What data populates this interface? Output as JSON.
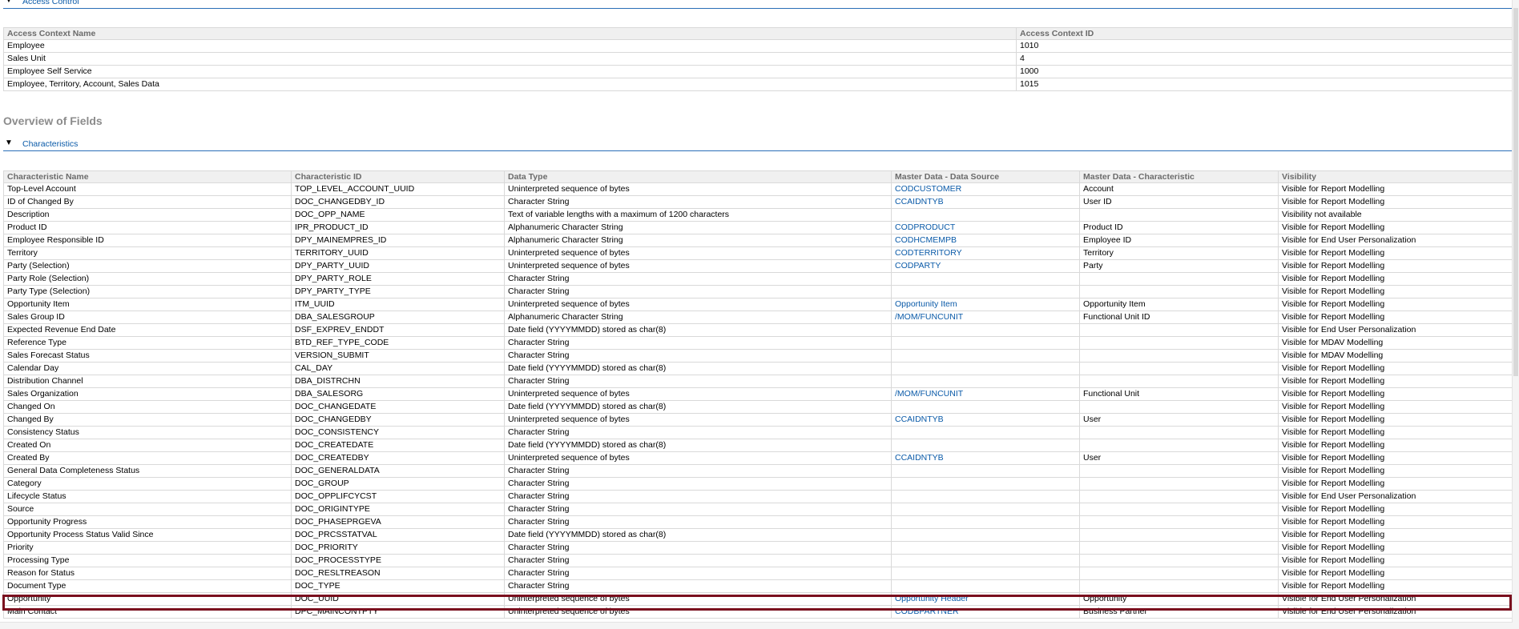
{
  "access_control": {
    "section_label": "Access Control",
    "columns": [
      "Access Context Name",
      "Access Context ID"
    ],
    "rows": [
      [
        "Employee",
        "1010"
      ],
      [
        "Sales Unit",
        "4"
      ],
      [
        "Employee Self Service",
        "1000"
      ],
      [
        "Employee, Territory, Account, Sales Data",
        "1015"
      ]
    ]
  },
  "overview_title": "Overview of Fields",
  "characteristics": {
    "section_label": "Characteristics",
    "columns": [
      "Characteristic Name",
      "Characteristic ID",
      "Data Type",
      "Master Data - Data Source",
      "Master Data - Characteristic",
      "Visibility"
    ],
    "rows": [
      [
        "Top-Level Account",
        "TOP_LEVEL_ACCOUNT_UUID",
        "Uninterpreted sequence of bytes",
        "CODCUSTOMER",
        "Account",
        "Visible for Report Modelling"
      ],
      [
        "ID of Changed By",
        "DOC_CHANGEDBY_ID",
        "Character String",
        "CCAIDNTYB",
        "User ID",
        "Visible for Report Modelling"
      ],
      [
        "Description",
        "DOC_OPP_NAME",
        "Text of variable lengths with a maximum of 1200 characters",
        "",
        "",
        "Visibility not available"
      ],
      [
        "Product ID",
        "IPR_PRODUCT_ID",
        "Alphanumeric Character String",
        "CODPRODUCT",
        "Product ID",
        "Visible for Report Modelling"
      ],
      [
        "Employee Responsible ID",
        "DPY_MAINEMPRES_ID",
        "Alphanumeric Character String",
        "CODHCMEMPB",
        "Employee ID",
        "Visible for End User Personalization"
      ],
      [
        "Territory",
        "TERRITORY_UUID",
        "Uninterpreted sequence of bytes",
        "CODTERRITORY",
        "Territory",
        "Visible for Report Modelling"
      ],
      [
        "Party (Selection)",
        "DPY_PARTY_UUID",
        "Uninterpreted sequence of bytes",
        "CODPARTY",
        "Party",
        "Visible for Report Modelling"
      ],
      [
        "Party Role (Selection)",
        "DPY_PARTY_ROLE",
        "Character String",
        "",
        "",
        "Visible for Report Modelling"
      ],
      [
        "Party Type (Selection)",
        "DPY_PARTY_TYPE",
        "Character String",
        "",
        "",
        "Visible for Report Modelling"
      ],
      [
        "Opportunity Item",
        "ITM_UUID",
        "Uninterpreted sequence of bytes",
        "Opportunity Item",
        "Opportunity Item",
        "Visible for Report Modelling"
      ],
      [
        "Sales Group ID",
        "DBA_SALESGROUP",
        "Alphanumeric Character String",
        "/MOM/FUNCUNIT",
        "Functional Unit ID",
        "Visible for Report Modelling"
      ],
      [
        "Expected Revenue End Date",
        "DSF_EXPREV_ENDDT",
        "Date field (YYYYMMDD) stored as char(8)",
        "",
        "",
        "Visible for End User Personalization"
      ],
      [
        "Reference Type",
        "BTD_REF_TYPE_CODE",
        "Character String",
        "",
        "",
        "Visible for MDAV Modelling"
      ],
      [
        "Sales Forecast Status",
        "VERSION_SUBMIT",
        "Character String",
        "",
        "",
        "Visible for MDAV Modelling"
      ],
      [
        "Calendar Day",
        "CAL_DAY",
        "Date field (YYYYMMDD) stored as char(8)",
        "",
        "",
        "Visible for Report Modelling"
      ],
      [
        "Distribution Channel",
        "DBA_DISTRCHN",
        "Character String",
        "",
        "",
        "Visible for Report Modelling"
      ],
      [
        "Sales Organization",
        "DBA_SALESORG",
        "Uninterpreted sequence of bytes",
        "/MOM/FUNCUNIT",
        "Functional Unit",
        "Visible for Report Modelling"
      ],
      [
        "Changed On",
        "DOC_CHANGEDATE",
        "Date field (YYYYMMDD) stored as char(8)",
        "",
        "",
        "Visible for Report Modelling"
      ],
      [
        "Changed By",
        "DOC_CHANGEDBY",
        "Uninterpreted sequence of bytes",
        "CCAIDNTYB",
        "User",
        "Visible for Report Modelling"
      ],
      [
        "Consistency Status",
        "DOC_CONSISTENCY",
        "Character String",
        "",
        "",
        "Visible for Report Modelling"
      ],
      [
        "Created On",
        "DOC_CREATEDATE",
        "Date field (YYYYMMDD) stored as char(8)",
        "",
        "",
        "Visible for Report Modelling"
      ],
      [
        "Created By",
        "DOC_CREATEDBY",
        "Uninterpreted sequence of bytes",
        "CCAIDNTYB",
        "User",
        "Visible for Report Modelling"
      ],
      [
        "General Data Completeness Status",
        "DOC_GENERALDATA",
        "Character String",
        "",
        "",
        "Visible for Report Modelling"
      ],
      [
        "Category",
        "DOC_GROUP",
        "Character String",
        "",
        "",
        "Visible for Report Modelling"
      ],
      [
        "Lifecycle Status",
        "DOC_OPPLIFCYCST",
        "Character String",
        "",
        "",
        "Visible for End User Personalization"
      ],
      [
        "Source",
        "DOC_ORIGINTYPE",
        "Character String",
        "",
        "",
        "Visible for Report Modelling"
      ],
      [
        "Opportunity Progress",
        "DOC_PHASEPRGEVA",
        "Character String",
        "",
        "",
        "Visible for Report Modelling"
      ],
      [
        "Opportunity Process Status Valid Since",
        "DOC_PRCSSTATVAL",
        "Date field (YYYYMMDD) stored as char(8)",
        "",
        "",
        "Visible for Report Modelling"
      ],
      [
        "Priority",
        "DOC_PRIORITY",
        "Character String",
        "",
        "",
        "Visible for Report Modelling"
      ],
      [
        "Processing Type",
        "DOC_PROCESSTYPE",
        "Character String",
        "",
        "",
        "Visible for Report Modelling"
      ],
      [
        "Reason for Status",
        "DOC_RESLTREASON",
        "Character String",
        "",
        "",
        "Visible for Report Modelling"
      ],
      [
        "Document Type",
        "DOC_TYPE",
        "Character String",
        "",
        "",
        "Visible for Report Modelling"
      ],
      [
        "Opportunity",
        "DOC_UUID",
        "Uninterpreted sequence of bytes",
        "Opportunity Header",
        "Opportunity",
        "Visible for End User Personalization"
      ],
      [
        "Main Contact",
        "DPC_MAINCONTPTY",
        "Uninterpreted sequence of bytes",
        "CODBPARTNER",
        "Business Partner",
        "Visible for End User Personalization"
      ]
    ]
  },
  "colors": {
    "link": "#0a5aa8",
    "header_bg": "#f0f0f0",
    "highlight_border": "#7a0f1e",
    "section_rule": "#2a6fb7"
  },
  "icons": {
    "section_toggle": "triangle-down-icon"
  }
}
